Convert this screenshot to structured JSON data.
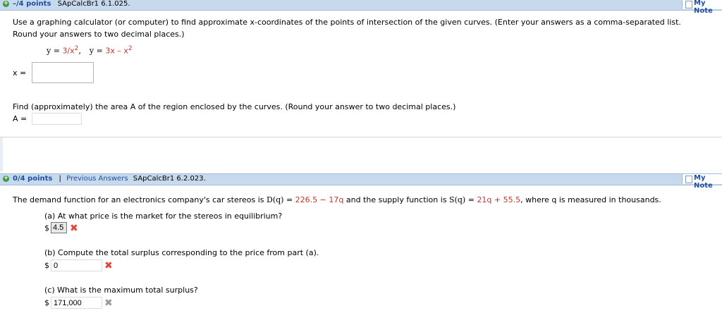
{
  "q1": {
    "points": "–/4 points",
    "qid": "SApCalcBr1 6.1.025.",
    "note": "My Note",
    "prompt1": "Use a graphing calculator (or computer) to find approximate x-coordinates of the points of intersection of the given curves. (Enter your answers as a comma-separated list.",
    "prompt2": "Round your answers to two decimal places.)",
    "eq1_lhs": "y = ",
    "eq1_rhs": "3/x",
    "eq1_exp": "2",
    "sep": ",",
    "eq2_lhs": "y = ",
    "eq2_rhs": "3x – x",
    "eq2_exp": "2",
    "x_label": "x =",
    "x_value": "",
    "area_prompt": "Find (approximately) the area A of the region enclosed by the curves. (Round your answer to two decimal places.)",
    "a_label": "A =",
    "a_value": ""
  },
  "q2": {
    "points": "0/4 points",
    "bar": "|",
    "prev": "Previous Answers",
    "qid": "SApCalcBr1 6.2.023.",
    "note": "My Note",
    "intro_a": "The demand function for an electronics company's car stereos is ",
    "d_fn": "D(q)",
    "eq_a": " = ",
    "d_expr": "226.5 − 17q",
    "intro_b": " and the supply function is ",
    "s_fn": "S(q)",
    "eq_b": " = ",
    "s_expr": "21q + 55.5",
    "intro_c": ", where q is measured in thousands.",
    "pa": "(a) At what price is the market for the stereos in equilibrium?",
    "pa_cur": "$",
    "pa_val": "4.5",
    "pb": "(b) Compute the total surplus corresponding to the price from part (a).",
    "pb_cur": "$",
    "pb_val": "0",
    "pc": "(c) What is the maximum total surplus?",
    "pc_cur": "$",
    "pc_val": "171,000",
    "wrong_mark": "✖"
  },
  "colors": {
    "header_bg": "#c7d9ec",
    "link": "#1d4fa3",
    "red": "#c0392b",
    "grey_x": "#999999"
  }
}
